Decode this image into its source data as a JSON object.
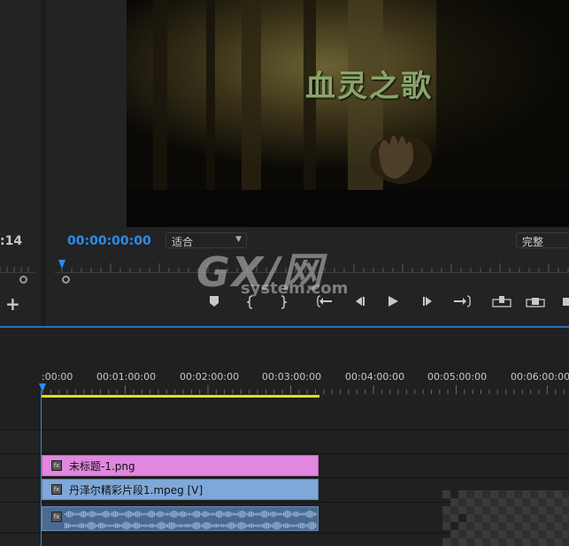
{
  "monitor": {
    "video_title": "血灵之歌",
    "current_timecode": "00:00:00:00",
    "fit_label": "适合",
    "quality_label": "完整",
    "left_timecode": ":14"
  },
  "controls": {
    "marker": "marker-icon",
    "in": "mark-in-icon",
    "out": "mark-out-icon",
    "go_in": "go-to-in-icon",
    "step_back": "step-back-icon",
    "play": "play-icon",
    "step_forward": "step-forward-icon",
    "go_out": "go-to-out-icon",
    "insert": "insert-icon",
    "overwrite": "overwrite-icon"
  },
  "watermark": {
    "main": "GX/网",
    "sub": "system.com"
  },
  "timeline": {
    "ruler_labels": [
      ":00:00",
      "00:01:00:00",
      "00:02:00:00",
      "00:03:00:00",
      "00:04:00:00",
      "00:05:00:00",
      "00:06:00:00"
    ],
    "clips": {
      "graphic": "未标题-1.png",
      "video": "丹泽尔精彩片段1.mpeg [V]"
    },
    "fx_badge": "fx"
  },
  "colors": {
    "accent": "#2d8ceb",
    "graphic_clip": "#e087e0",
    "video_clip": "#7ea8d8",
    "audio_clip": "#4a6a92",
    "work_area": "#e8dd20"
  }
}
